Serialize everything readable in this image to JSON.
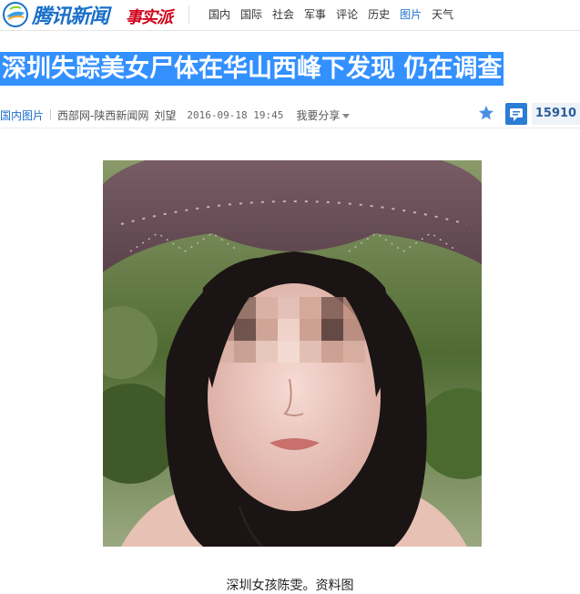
{
  "header": {
    "logo_text": "腾讯新闻",
    "brand2_text": "事实派",
    "nav": [
      "国内",
      "国际",
      "社会",
      "军事",
      "评论",
      "历史",
      "图片",
      "天气"
    ],
    "active_nav": "图片"
  },
  "article": {
    "title": "深圳失踪美女尸体在华山西峰下发现 仍在调查",
    "category": "国内图片",
    "source": "西部网-陕西新闻网",
    "author": "刘望",
    "time": "2016-09-18 19:45",
    "share_label": "我要分享",
    "comment_count": "15910",
    "photo_caption": "深圳女孩陈雯。资料图"
  },
  "colors": {
    "accent": "#1a6fc9",
    "title_highlight": "#3390ff",
    "brand_red": "#d0021b"
  },
  "icons": {
    "logo": "tencent-news-logo",
    "favorite": "star-icon",
    "comment": "comment-icon",
    "dropdown": "caret-down-icon"
  }
}
